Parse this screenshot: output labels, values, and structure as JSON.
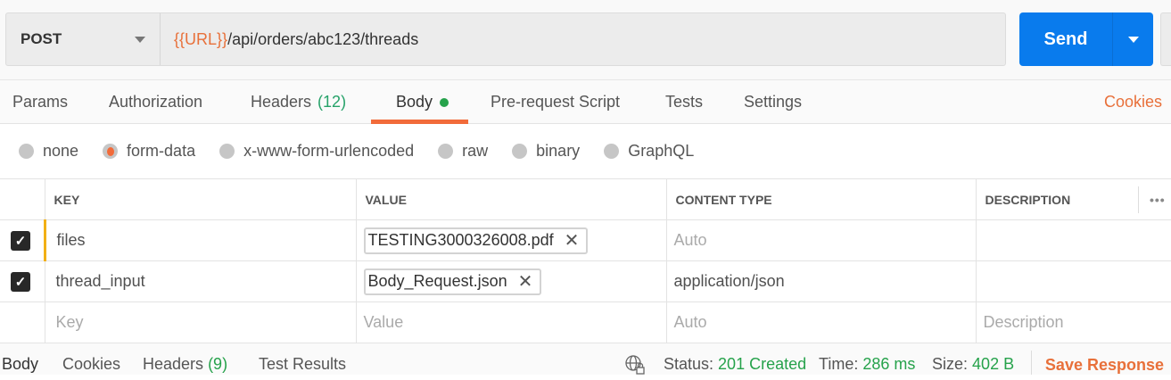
{
  "request": {
    "method": "POST",
    "url_variable": "{{URL}}",
    "url_path": "/api/orders/abc123/threads",
    "send_label": "Send"
  },
  "tabs": [
    {
      "label": "Params"
    },
    {
      "label": "Authorization"
    },
    {
      "label": "Headers",
      "count": "(12)"
    },
    {
      "label": "Body",
      "active": true
    },
    {
      "label": "Pre-request Script"
    },
    {
      "label": "Tests"
    },
    {
      "label": "Settings"
    }
  ],
  "right_link": "Cookies",
  "body_types": [
    {
      "label": "none"
    },
    {
      "label": "form-data",
      "selected": true
    },
    {
      "label": "x-www-form-urlencoded"
    },
    {
      "label": "raw"
    },
    {
      "label": "binary"
    },
    {
      "label": "GraphQL"
    }
  ],
  "table": {
    "headers": [
      "KEY",
      "VALUE",
      "CONTENT TYPE",
      "DESCRIPTION"
    ],
    "more": "•••",
    "rows": [
      {
        "key": "files",
        "value": "TESTING3000326008.pdf",
        "content_type": "Auto",
        "checked": true
      },
      {
        "key": "thread_input",
        "value": "Body_Request.json",
        "content_type": "application/json",
        "checked": true
      }
    ],
    "placeholders": {
      "key": "Key",
      "value": "Value",
      "content_type": "Auto",
      "description": "Description"
    },
    "remove_glyph": "✕"
  },
  "response": {
    "tabs": [
      "Body",
      "Cookies",
      "Headers",
      "Test Results"
    ],
    "headers_count": "(9)",
    "status_label": "Status:",
    "status": "201 Created",
    "time_label": "Time:",
    "time": "286 ms",
    "size_label": "Size:",
    "size": "402 B",
    "save_label": "Save Response"
  },
  "colors": {
    "accent": "#f26b3a",
    "send": "#097bed",
    "success": "#26a24b"
  }
}
